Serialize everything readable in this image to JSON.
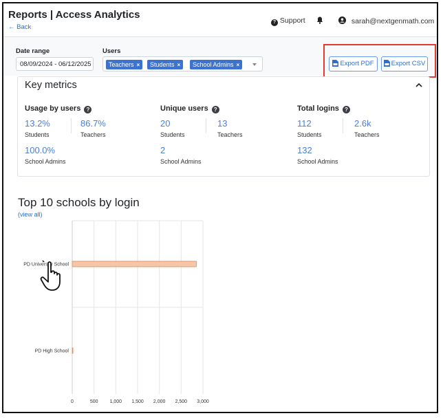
{
  "header": {
    "title": "Reports | Access Analytics",
    "back_label": "← Back",
    "support_label": "Support",
    "user_email": "sarah@nextgenmath.com"
  },
  "filters": {
    "date_range_label": "Date range",
    "date_range_value": "08/09/2024 - 06/12/2025",
    "users_label": "Users",
    "users_selected": [
      "Teachers",
      "Students",
      "School Admins"
    ],
    "export_pdf_label": "Export PDF",
    "export_csv_label": "Export CSV"
  },
  "key_metrics": {
    "title": "Key metrics",
    "usage": {
      "title": "Usage by users",
      "items": [
        {
          "value": "13.2%",
          "label": "Students"
        },
        {
          "value": "86.7%",
          "label": "Teachers"
        },
        {
          "value": "100.0%",
          "label": "School Admins"
        }
      ]
    },
    "unique": {
      "title": "Unique users",
      "items": [
        {
          "value": "20",
          "label": "Students"
        },
        {
          "value": "13",
          "label": "Teachers"
        },
        {
          "value": "2",
          "label": "School Admins"
        }
      ]
    },
    "logins": {
      "title": "Total logins",
      "items": [
        {
          "value": "112",
          "label": "Students"
        },
        {
          "value": "2.6k",
          "label": "Teachers"
        },
        {
          "value": "132",
          "label": "School Admins"
        }
      ]
    }
  },
  "top_schools": {
    "title": "Top 10 schools by login",
    "view_all_label": "(view all)"
  },
  "colors": {
    "accent": "#2f6fd0",
    "chip": "#3c73cf",
    "highlight": "#e3392f",
    "bar_fill": "#f5c6a8",
    "bar_stroke": "#e08a5a"
  },
  "chart_data": {
    "type": "bar",
    "orientation": "horizontal",
    "categories": [
      "PD University School",
      "PD High School"
    ],
    "values": [
      2850,
      15
    ],
    "xlim": [
      0,
      3000
    ],
    "xticks": [
      0,
      500,
      1000,
      1500,
      2000,
      2500,
      3000
    ],
    "xtick_labels": [
      "0",
      "500",
      "1,000",
      "1,500",
      "2,000",
      "2,500",
      "3,000"
    ],
    "grid": true
  }
}
